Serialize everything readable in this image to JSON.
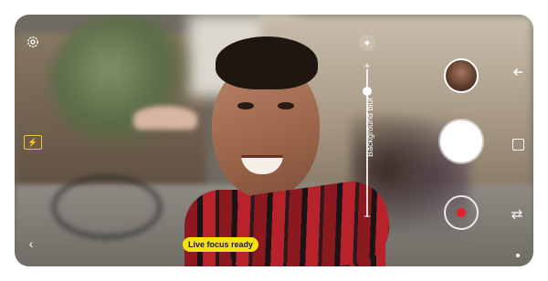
{
  "camera": {
    "mode": "Live focus",
    "toast": "Live focus ready",
    "slider": {
      "label": "Background blur",
      "plus": "+",
      "minus": "–",
      "level": 0.85
    },
    "icons": {
      "settings": "gear-icon",
      "flash": "flash-off-icon",
      "back": "chevron-left-icon",
      "bokeh": "bokeh-effect-icon",
      "gallery_thumbnail": "gallery-thumbnail",
      "nav_back": "back-arrow-icon",
      "nav_recents": "square-icon",
      "nav_switch": "switch-camera-icon"
    },
    "colors": {
      "toast_bg": "#f6e20f",
      "flash_icon": "#f2c230",
      "record": "#e5202a"
    }
  }
}
